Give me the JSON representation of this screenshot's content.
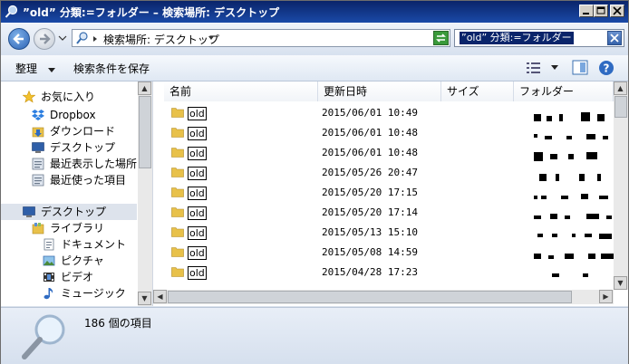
{
  "window": {
    "title": "”old” 分類:=フォルダー – 検索場所: デスクトップ"
  },
  "address": {
    "path": "検索場所: デスクトップ"
  },
  "search": {
    "query": "”old” 分類:=フォルダー"
  },
  "toolbar": {
    "organize_label": "整理",
    "save_search_label": "検索条件を保存"
  },
  "nav": {
    "favorites": [
      {
        "label": "お気に入り",
        "icon": "star-icon"
      },
      {
        "label": "Dropbox",
        "icon": "dropbox-icon"
      },
      {
        "label": "ダウンロード",
        "icon": "download-folder-icon"
      },
      {
        "label": "デスクトップ",
        "icon": "desktop-icon"
      },
      {
        "label": "最近表示した場所",
        "icon": "recent-places-icon"
      },
      {
        "label": "最近使った項目",
        "icon": "recent-items-icon"
      }
    ],
    "tree": [
      {
        "label": "デスクトップ",
        "icon": "desktop-icon"
      },
      {
        "label": "ライブラリ",
        "icon": "library-icon"
      },
      {
        "label": "ドキュメント",
        "icon": "documents-icon"
      },
      {
        "label": "ピクチャ",
        "icon": "pictures-icon"
      },
      {
        "label": "ビデオ",
        "icon": "video-icon"
      },
      {
        "label": "ミュージック",
        "icon": "music-icon"
      }
    ]
  },
  "columns": {
    "name": "名前",
    "date": "更新日時",
    "size": "サイズ",
    "folder": "フォルダー"
  },
  "files": [
    {
      "name": "old",
      "date": "2015/06/01 10:49"
    },
    {
      "name": "old",
      "date": "2015/06/01 10:48"
    },
    {
      "name": "old",
      "date": "2015/06/01 10:48"
    },
    {
      "name": "old",
      "date": "2015/05/26 20:47"
    },
    {
      "name": "old",
      "date": "2015/05/20 17:15"
    },
    {
      "name": "old",
      "date": "2015/05/20 17:14"
    },
    {
      "name": "old",
      "date": "2015/05/13 15:10"
    },
    {
      "name": "old",
      "date": "2015/05/08 14:59"
    },
    {
      "name": "old",
      "date": "2015/04/28 17:23"
    }
  ],
  "status": {
    "count_text": "186 個の項目"
  },
  "colors": {
    "title_bar": "#0a246a",
    "selection": "#0a246a",
    "folder": "#e8c14a"
  }
}
